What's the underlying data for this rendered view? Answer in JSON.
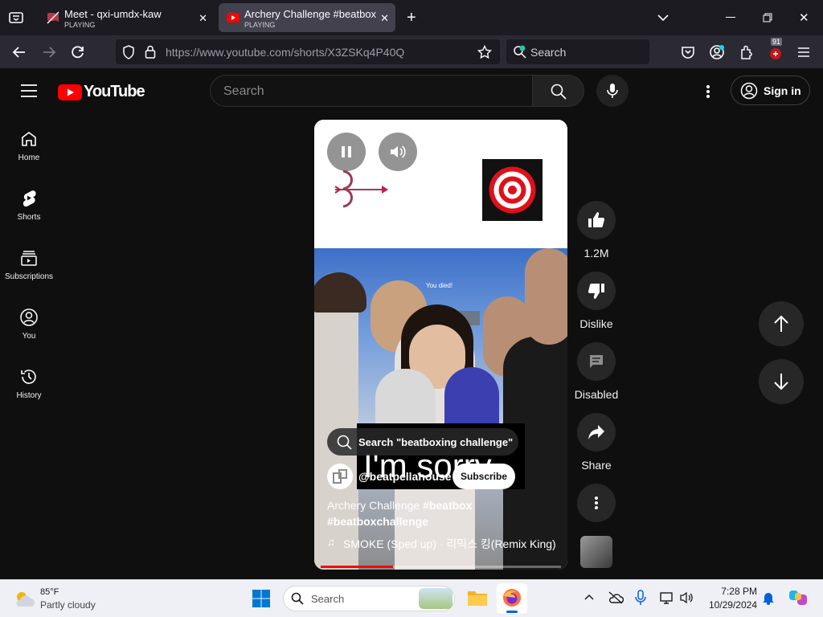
{
  "browser": {
    "tabs": [
      {
        "title": "Meet - qxi-umdx-kaw",
        "status": "PLAYING"
      },
      {
        "title": "Archery Challenge #beatbox #b",
        "status": "PLAYING"
      }
    ],
    "url": "https://www.youtube.com/shorts/X3ZSKq4P40Q",
    "search_placeholder": "Search",
    "notification_count": "91"
  },
  "youtube": {
    "logo_text": "YouTube",
    "search_placeholder": "Search",
    "sign_in_label": "Sign in",
    "sidebar": [
      {
        "label": "Home",
        "icon": "home-icon"
      },
      {
        "label": "Shorts",
        "icon": "shorts-icon"
      },
      {
        "label": "Subscriptions",
        "icon": "subscriptions-icon"
      },
      {
        "label": "You",
        "icon": "you-icon"
      },
      {
        "label": "History",
        "icon": "history-icon"
      }
    ],
    "short": {
      "overlay_caption": "I'm sorry",
      "game_text": "You died!",
      "search_suggestion": "Search \"beatboxing challenge\"",
      "channel": "@beatpellahouse",
      "subscribe_label": "Subscribe",
      "title_plain": "Archery Challenge ",
      "title_tag1": "#beatbox",
      "title_tag2": "#beatboxchallenge",
      "music": "SMOKE (Sped up) · 리믹스 킹(Remix King)",
      "progress": 0.3
    },
    "actions": {
      "likes": "1.2M",
      "dislike_label": "Dislike",
      "comments_label": "Disabled",
      "share_label": "Share"
    }
  },
  "taskbar": {
    "temperature": "85°F",
    "condition": "Partly cloudy",
    "search_placeholder": "Search",
    "time": "7:28 PM",
    "date": "10/29/2024"
  },
  "colors": {
    "youtube_red": "#ff0000",
    "firefox_blue": "#0060df",
    "progress_red": "#ff0000"
  }
}
